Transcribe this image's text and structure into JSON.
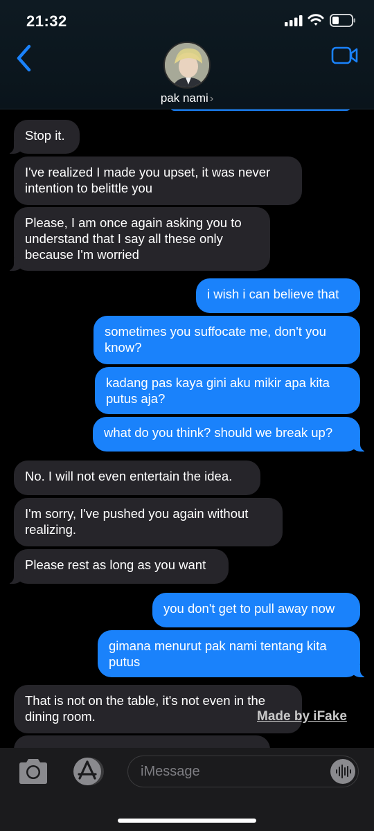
{
  "status_bar": {
    "time": "21:32"
  },
  "header": {
    "contact_name": "pak nami",
    "chevron": "›"
  },
  "colors": {
    "incoming_bubble": "#26252a",
    "outgoing_bubble": "#1a82fb",
    "accent": "#1a82fb",
    "background": "#000000"
  },
  "icons": {
    "back": "chevron-left-icon",
    "video": "video-camera-icon",
    "camera": "camera-icon",
    "apps": "app-store-icon",
    "audio": "audio-waveform-icon",
    "signal": "cellular-signal-icon",
    "wifi": "wifi-icon",
    "battery": "battery-icon"
  },
  "messages": [
    {
      "dir": "in",
      "text": "Stop it.",
      "tail": true
    },
    {
      "dir": "in",
      "text": "I've realized I made you upset, it was never intention to belittle you",
      "tail": false
    },
    {
      "dir": "in",
      "text": "Please, I am once again asking you to understand that I say all these only because I'm worried",
      "tail": true
    },
    {
      "dir": "out",
      "text": "i wish i can believe that",
      "tail": false
    },
    {
      "dir": "out",
      "text": "sometimes you suffocate me, don't you know?",
      "tail": false
    },
    {
      "dir": "out",
      "text": "kadang pas kaya gini aku mikir apa kita putus aja?",
      "tail": false
    },
    {
      "dir": "out",
      "text": "what do you think? should we break up?",
      "tail": true
    },
    {
      "dir": "in",
      "text": "No. I will not even entertain the idea.",
      "tail": false
    },
    {
      "dir": "in",
      "text": "I'm sorry, I've pushed you again without realizing.",
      "tail": false
    },
    {
      "dir": "in",
      "text": "Please rest as long as you want",
      "tail": true
    },
    {
      "dir": "out",
      "text": "you don't get to pull away now",
      "tail": false
    },
    {
      "dir": "out",
      "text": "gimana menurut pak nami tentang kita putus",
      "tail": true
    },
    {
      "dir": "in",
      "text": "That is not on the table, it's not even in the dining room.",
      "tail": false
    }
  ],
  "watermark": "Made by iFake",
  "composer": {
    "placeholder": "iMessage"
  }
}
